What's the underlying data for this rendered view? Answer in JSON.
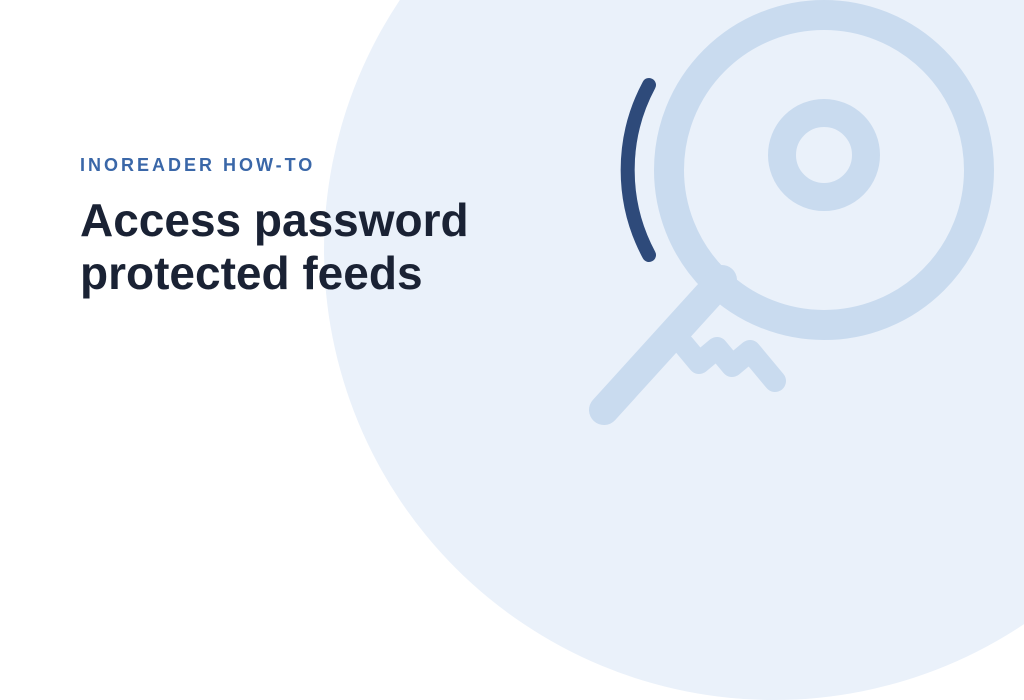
{
  "hero": {
    "eyebrow": "INOREADER HOW-TO",
    "headline": "Access password protected feeds"
  },
  "colors": {
    "accent_dark": "#2e4a7a",
    "accent_light": "#c9dbef",
    "background_tint": "#eaf1fa",
    "text_primary": "#1a2234"
  },
  "icon": {
    "name": "key-icon"
  }
}
